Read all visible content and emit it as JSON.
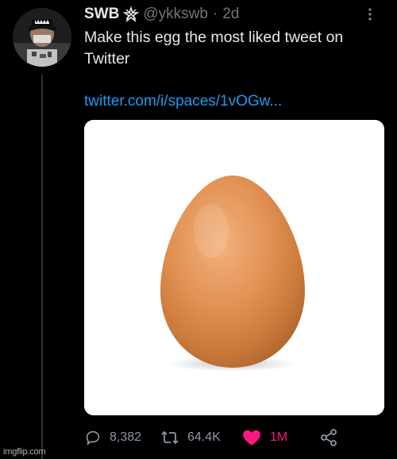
{
  "tweet": {
    "display_name": "SWB",
    "handle": "@ykkswb",
    "separator": "·",
    "time": "2d",
    "text": "Make this egg the most liked tweet on Twitter",
    "link": "twitter.com/i/spaces/1vOGw..."
  },
  "icons": {
    "verified_badge": "star-badge-icon",
    "more": "more-icon",
    "reply": "reply-icon",
    "retweet": "retweet-icon",
    "like": "heart-icon",
    "share": "share-icon"
  },
  "actions": {
    "replies": "8,382",
    "retweets": "64.4K",
    "likes": "1M"
  },
  "watermark": "imgflip.com",
  "colors": {
    "background": "#000000",
    "text": "#e7e9ea",
    "muted": "#71767b",
    "link": "#1d9bf0",
    "like": "#f91880"
  }
}
